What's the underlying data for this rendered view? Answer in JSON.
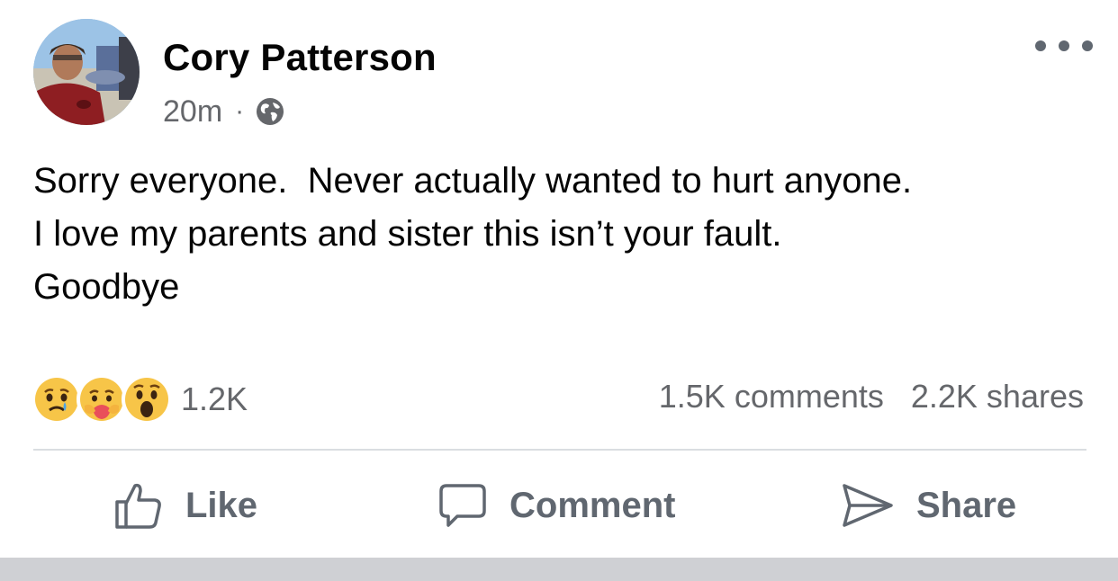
{
  "post": {
    "author": "Cory Patterson",
    "timestamp": "20m",
    "separator": "·",
    "privacy_icon": "globe-icon",
    "more_icon": "more-options-icon",
    "text_lines": [
      "Sorry everyone.  Never actually wanted to hurt anyone.",
      "I love my parents and sister this isn’t your fault.",
      "Goodbye"
    ]
  },
  "stats": {
    "reactions": [
      "sad-emoji",
      "care-emoji",
      "wow-emoji"
    ],
    "reaction_count": "1.2K",
    "comments": "1.5K comments",
    "shares": "2.2K shares"
  },
  "actions": {
    "like": "Like",
    "comment": "Comment",
    "share": "Share"
  },
  "colors": {
    "text_primary": "#050505",
    "text_secondary": "#65676b",
    "action_gray": "#606770",
    "reaction_yellow": "#f7c548"
  }
}
